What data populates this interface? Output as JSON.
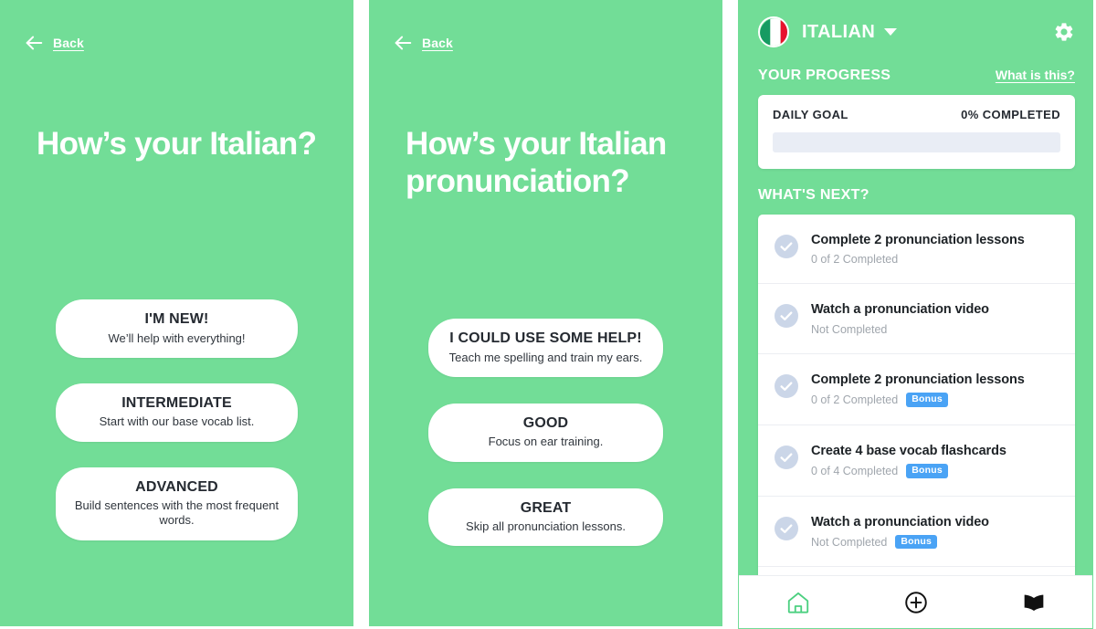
{
  "screen_level": {
    "back": {
      "label": "Back",
      "icon": "arrow-left-icon"
    },
    "headline": "How’s your Italian?",
    "choices": [
      {
        "title": "I'M NEW!",
        "subtitle": "We’ll help with everything!"
      },
      {
        "title": "INTERMEDIATE",
        "subtitle": "Start with our base vocab list."
      },
      {
        "title": "ADVANCED",
        "subtitle": "Build sentences with the most frequent words."
      }
    ]
  },
  "screen_pronunciation": {
    "back": {
      "label": "Back",
      "icon": "arrow-left-icon"
    },
    "headline": "How’s your Italian pronunciation?",
    "choices": [
      {
        "title": "I COULD USE SOME HELP!",
        "subtitle": "Teach me spelling and train my ears."
      },
      {
        "title": "GOOD",
        "subtitle": "Focus on ear training."
      },
      {
        "title": "GREAT",
        "subtitle": "Skip all pronunciation lessons."
      }
    ]
  },
  "screen_home": {
    "language": {
      "name": "ITALIAN",
      "flag_icon": "italy-flag-icon",
      "caret_icon": "chevron-down-icon"
    },
    "settings_icon": "gear-icon",
    "progress": {
      "section_title": "YOUR PROGRESS",
      "help_link": "What is this?",
      "goal_label": "DAILY GOAL",
      "percent_label": "0% COMPLETED",
      "percent_value": 0
    },
    "whats_next": {
      "section_title": "WHAT'S NEXT?",
      "tasks": [
        {
          "title": "Complete 2 pronunciation lessons",
          "status": "0 of 2 Completed",
          "badge": "",
          "check_icon": "check-circle-icon"
        },
        {
          "title": "Watch a pronunciation video",
          "status": "Not Completed",
          "badge": "",
          "check_icon": "check-circle-icon"
        },
        {
          "title": "Complete 2 pronunciation lessons",
          "status": "0 of 2 Completed",
          "badge": "Bonus",
          "check_icon": "check-circle-icon"
        },
        {
          "title": "Create 4 base vocab flashcards",
          "status": "0 of 4 Completed",
          "badge": "Bonus",
          "check_icon": "check-circle-icon"
        },
        {
          "title": "Watch a pronunciation video",
          "status": "Not Completed",
          "badge": "Bonus",
          "check_icon": "check-circle-icon"
        }
      ]
    },
    "bottom_nav": [
      {
        "icon": "home-icon",
        "active": true
      },
      {
        "icon": "plus-circle-icon",
        "active": false
      },
      {
        "icon": "book-icon",
        "active": false
      }
    ]
  },
  "colors": {
    "brand_green": "#72DD97",
    "card_white": "#FFFFFF",
    "badge_blue": "#4AA3F5",
    "progress_track": "#E9EDF5",
    "check_circle": "#CBD6E8",
    "text_dark": "#252A31",
    "text_muted": "#A0A6AD"
  }
}
